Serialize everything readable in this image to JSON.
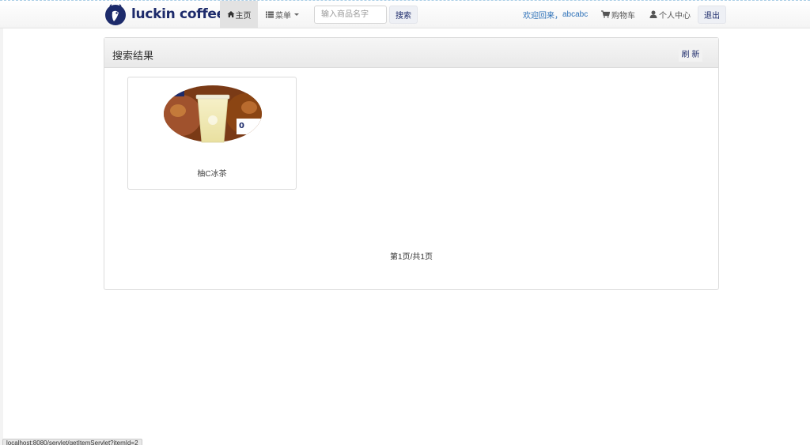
{
  "navbar": {
    "brand": "luckin coffee",
    "home_label": "主页",
    "menu_label": "菜单",
    "search": {
      "placeholder": "输入商品名字",
      "value": "",
      "button_label": "搜索"
    },
    "welcome_prefix": "欢迎回来，",
    "username": "abcabc",
    "cart_label": "购物车",
    "profile_label": "个人中心",
    "logout_label": "退出"
  },
  "panel": {
    "title": "搜索结果",
    "refresh_label": "刷 新"
  },
  "products": [
    {
      "name": "柚C冰茶"
    }
  ],
  "pagination": {
    "text": "第1页/共1页"
  },
  "status_bar": {
    "url": "localhost:8080/servlet/getItemServlet?itemId=2"
  },
  "colors": {
    "brand_navy": "#1d2b6b",
    "link_blue": "#2a6fb7",
    "home_active_bg": "#e2e2e2"
  },
  "icons": [
    "luckin-deer-logo",
    "home-icon",
    "list-icon",
    "cart-icon",
    "user-icon"
  ]
}
